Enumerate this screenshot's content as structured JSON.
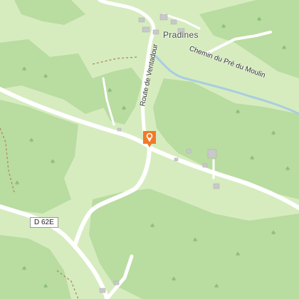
{
  "map": {
    "places": [
      {
        "name": "Pradines"
      }
    ],
    "roads": [
      {
        "name": "Route de Ventadour"
      },
      {
        "name": "Chemin du Pré du Moulin"
      }
    ],
    "road_refs": [
      {
        "ref": "D 62E"
      }
    ],
    "marker": {
      "icon": "map-pin-icon",
      "color": "#f07a2a"
    },
    "colors": {
      "forest": "#b9dca0",
      "meadow": "#d6ecbf",
      "road": "#ffffff",
      "water": "#a9cde0",
      "path": "#b08a5a",
      "building": "#c9c9c9"
    }
  }
}
